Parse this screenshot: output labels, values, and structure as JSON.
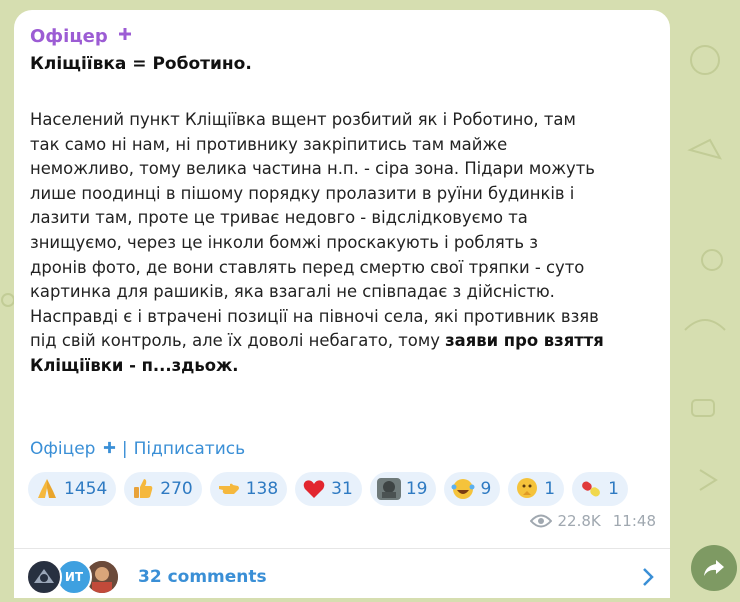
{
  "post": {
    "author": "Офіцер",
    "title": "Кліщіївка = Роботино.",
    "body_lines": [
      "Населений пункт Кліщіївка вщент розбитий як і Роботино, там",
      "так само ні нам, ні противнику закріпитись там майже",
      "неможливо, тому велика частина н.п. - сіра зона. Підари можуть",
      "лише поодинці в пішому порядку пролазити в руїни будинків і",
      "лазити там, проте це триває недовго - відслідковуємо та",
      "знищуємо, через це інколи бомжі проскакують і роблять з",
      "дронів фото, де вони ставлять перед смертю свої тряпки - суто",
      "картинка для рашиків, яка взагалі не співпадає з дійсністю.",
      "Насправді є і втрачені позиції на півночі села, які противник взяв",
      "під свій контроль, але їх доволі небагато, тому "
    ],
    "bold_tail_1": "заяви про взяття",
    "bold_tail_2": "Кліщіївки - п...здьож.",
    "signature_name": "Офіцер",
    "signature_sep": "|",
    "subscribe_label": "Підписатись",
    "reactions": [
      {
        "icon": "pray-icon",
        "count": "1454"
      },
      {
        "icon": "thumbs-up-icon",
        "count": "270"
      },
      {
        "icon": "pointing-hand-icon",
        "count": "138"
      },
      {
        "icon": "heart-icon",
        "count": "31"
      },
      {
        "icon": "custom-sticker-icon",
        "count": "19"
      },
      {
        "icon": "rofl-icon",
        "count": "9"
      },
      {
        "icon": "thinking-icon",
        "count": "1"
      },
      {
        "icon": "pill-icon",
        "count": "1"
      }
    ],
    "views": "22.8K",
    "time": "11:48",
    "comments_label": "32 comments",
    "avatar_initials": "ИТ"
  },
  "colors": {
    "accent": "#3a8fd6",
    "author": "#9c5cd4",
    "reaction_bg": "#e8f1fb",
    "background": "#d6deb0",
    "share_button": "#7e9a63"
  }
}
